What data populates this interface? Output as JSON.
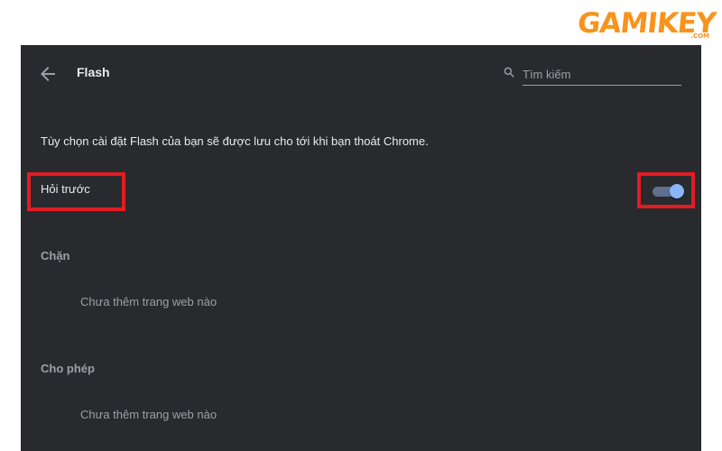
{
  "watermark": {
    "brand": "GAMIKEY",
    "tld": ".COM"
  },
  "header": {
    "title": "Flash",
    "back_icon": "arrow-left-icon",
    "search": {
      "icon": "search-icon",
      "placeholder": "Tìm kiếm",
      "value": ""
    }
  },
  "info_text": "Tùy chọn cài đặt Flash của bạn sẽ được lưu cho tới khi bạn thoát Chrome.",
  "ask_first": {
    "label": "Hỏi trước",
    "enabled": true
  },
  "blocked": {
    "label": "Chặn",
    "empty": "Chưa thêm trang web nào"
  },
  "allowed": {
    "label": "Cho phép",
    "empty": "Chưa thêm trang web nào"
  },
  "colors": {
    "panel_bg": "#292a2d",
    "text": "#e8eaed",
    "secondary_text": "#9aa0a6",
    "toggle_knob": "#8ab4f8",
    "highlight": "#e31b23",
    "brand": "#f7941d"
  }
}
